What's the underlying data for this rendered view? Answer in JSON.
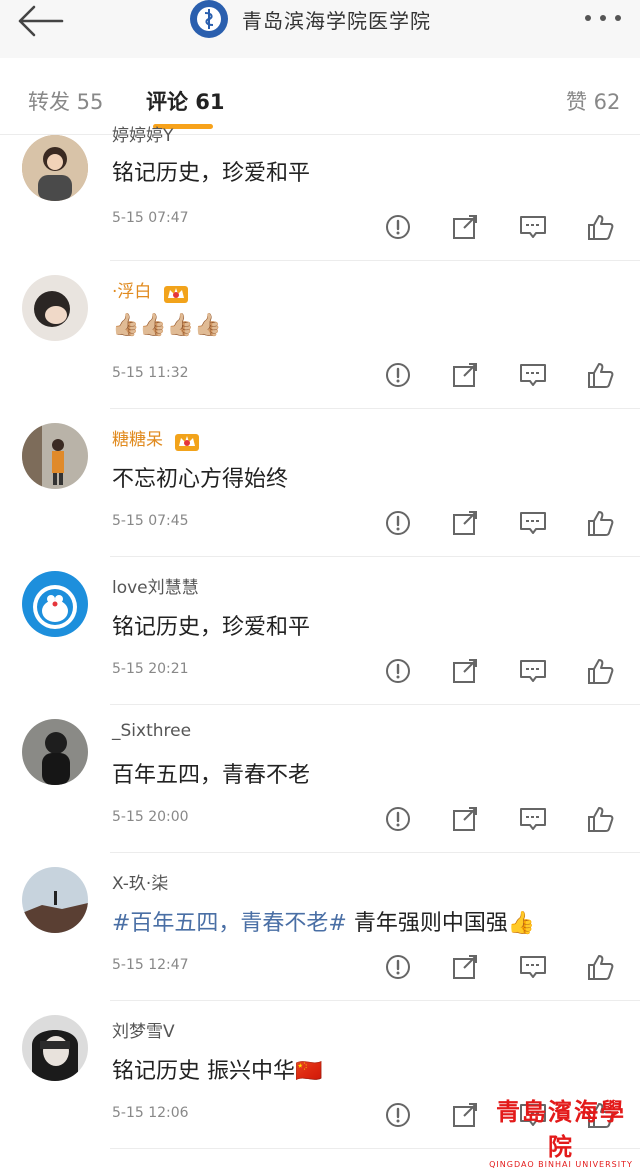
{
  "header": {
    "title": "青岛滨海学院医学院",
    "back_icon": "arrow-left-icon",
    "more_icon": "more-dots-icon"
  },
  "tabs": {
    "repost": "转发 55",
    "comments": "评论 61",
    "likes": "赞 62",
    "active_color": "#f7a21b"
  },
  "comments": [
    {
      "username": "婷婷婷Y",
      "text": "铭记历史，珍爱和平",
      "time": "5-15 07:47"
    },
    {
      "username": "·浮白",
      "text": "👍🏼👍🏼👍🏼👍🏼",
      "time": "5-15 11:32"
    },
    {
      "username": "糖糖呆",
      "text": "不忘初心方得始终",
      "time": "5-15 07:45"
    },
    {
      "username": "love刘慧慧",
      "text": "铭记历史，珍爱和平",
      "time": "5-15 20:21"
    },
    {
      "username": "_Sixthree",
      "text": "百年五四，青春不老",
      "time": "5-15 20:00"
    },
    {
      "username": "X-玖·柒",
      "topic": "#百年五四，青春不老#",
      "text": " 青年强则中国强👍",
      "time": "5-15 12:47"
    },
    {
      "username": "刘梦雪V",
      "text": "铭记历史 振兴中华🇨🇳",
      "time": "5-15 12:06"
    }
  ],
  "watermark": {
    "cn": "青島濱海學院",
    "en": "QINGDAO BINHAI UNIVERSITY"
  },
  "colors": {
    "topic": "#4a6fa5",
    "vip_name": "#e08a1e",
    "watermark": "#e31a1a"
  }
}
